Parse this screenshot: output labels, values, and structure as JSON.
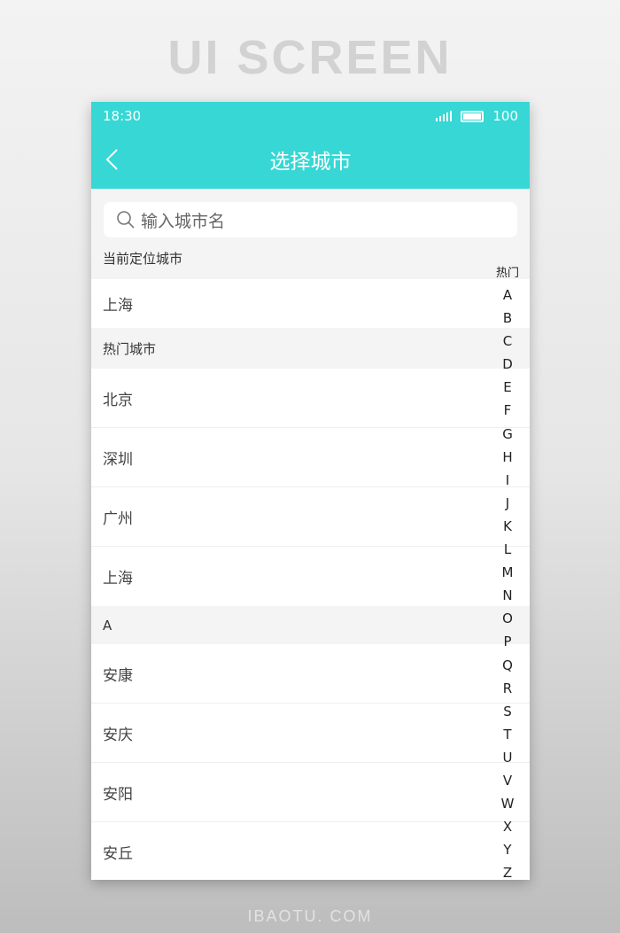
{
  "banner": {
    "title": "UI SCREEN",
    "footer": "IBAOTU. COM"
  },
  "status": {
    "time": "18:30",
    "battery": "100"
  },
  "nav": {
    "title": "选择城市",
    "back_icon": "chevron-left-icon"
  },
  "search": {
    "placeholder": "输入城市名"
  },
  "current": {
    "label": "当前定位城市",
    "city": "上海"
  },
  "hot": {
    "label": "热门城市",
    "cities": [
      "北京",
      "深圳",
      "广州",
      "上海"
    ]
  },
  "groupA": {
    "label": "A",
    "cities": [
      "安康",
      "安庆",
      "安阳",
      "安丘"
    ]
  },
  "index": {
    "hot": "热门",
    "letters": [
      "A",
      "B",
      "C",
      "D",
      "E",
      "F",
      "G",
      "H",
      "I",
      "J",
      "K",
      "L",
      "M",
      "N",
      "O",
      "P",
      "Q",
      "R",
      "S",
      "T",
      "U",
      "V",
      "W",
      "X",
      "Y",
      "Z"
    ]
  },
  "colors": {
    "accent": "#36d7d4"
  }
}
